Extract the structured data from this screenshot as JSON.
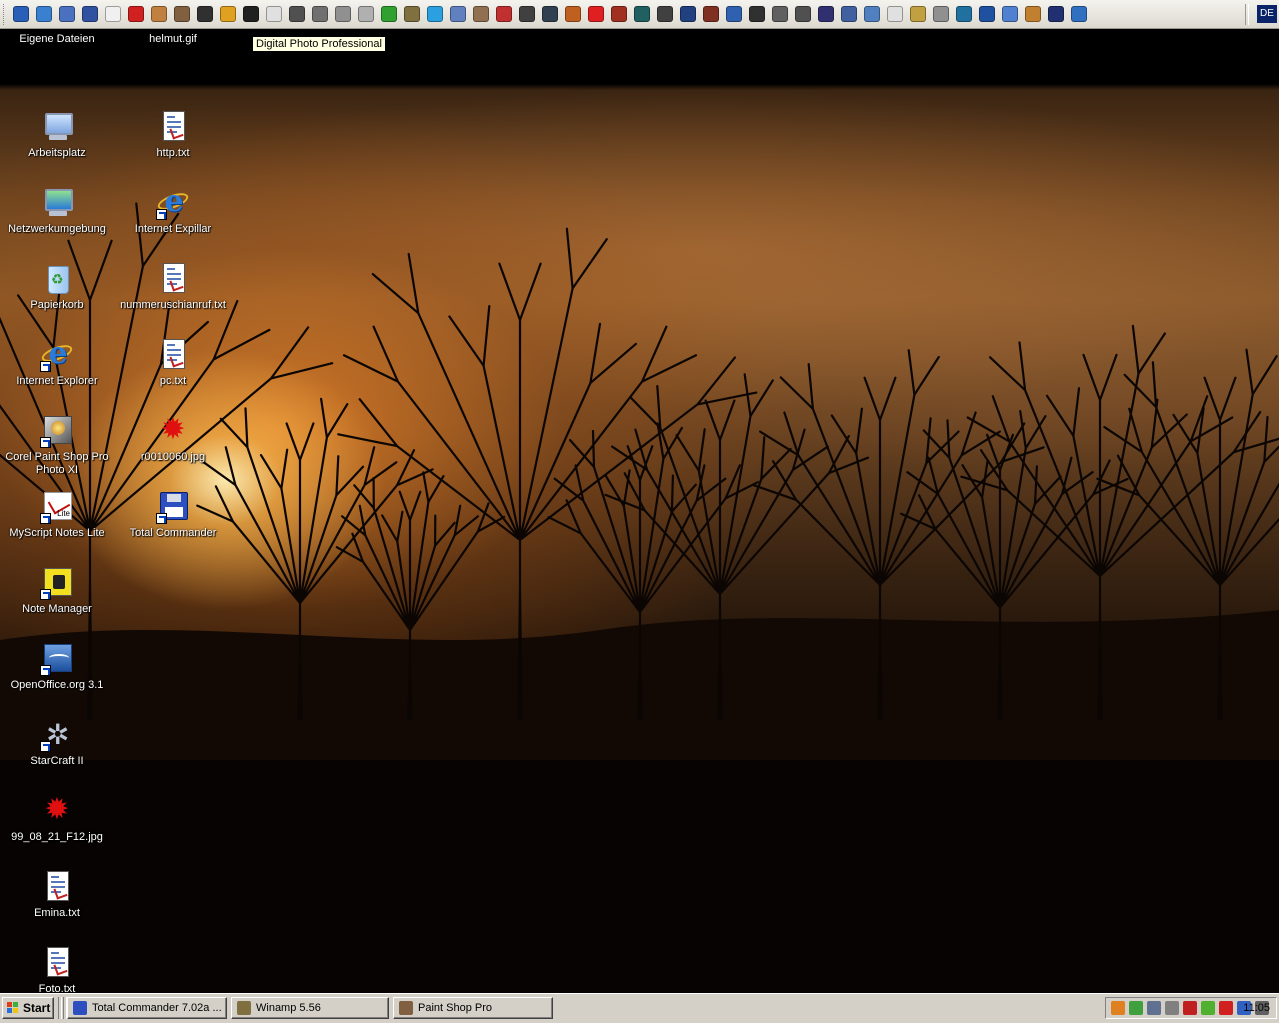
{
  "tooltip": "Digital Photo Professional",
  "language_indicator": "DE",
  "quick_launch": [
    {
      "icon": "outlook-icon",
      "color": "#2a5fb8"
    },
    {
      "icon": "ie-icon",
      "color": "#3a80d0"
    },
    {
      "icon": "desktop-icon",
      "color": "#4a70c0"
    },
    {
      "icon": "save-icon",
      "color": "#3050a0"
    },
    {
      "icon": "window-icon",
      "color": "#f0f0f0"
    },
    {
      "icon": "star-icon",
      "color": "#d02020"
    },
    {
      "icon": "pen-icon",
      "color": "#c08040"
    },
    {
      "icon": "tools-icon",
      "color": "#806040"
    },
    {
      "icon": "photo-icon",
      "color": "#303030"
    },
    {
      "icon": "media-icon",
      "color": "#e0a020"
    },
    {
      "icon": "camera-icon",
      "color": "#202020"
    },
    {
      "icon": "home-icon",
      "color": "#e0e0e0"
    },
    {
      "icon": "edit-icon",
      "color": "#505050"
    },
    {
      "icon": "monitor-icon",
      "color": "#707070"
    },
    {
      "icon": "calculator-icon",
      "color": "#909090"
    },
    {
      "icon": "avi-icon",
      "color": "#b0b0b0"
    },
    {
      "icon": "flower-icon",
      "color": "#30a030"
    },
    {
      "icon": "winamp-icon",
      "color": "#807040"
    },
    {
      "icon": "skype-icon",
      "color": "#2aa0e0"
    },
    {
      "icon": "grid-icon",
      "color": "#6080c0"
    },
    {
      "icon": "film-icon",
      "color": "#907050"
    },
    {
      "icon": "record-icon",
      "color": "#c03030"
    },
    {
      "icon": "clapper-icon",
      "color": "#404040"
    },
    {
      "icon": "book-icon",
      "color": "#304050"
    },
    {
      "icon": "people-icon",
      "color": "#c06020"
    },
    {
      "icon": "stop-icon",
      "color": "#e02020"
    },
    {
      "icon": "agent-icon",
      "color": "#a03020"
    },
    {
      "icon": "globe-icon",
      "color": "#206060"
    },
    {
      "icon": "wings-icon",
      "color": "#404040"
    },
    {
      "icon": "v-icon",
      "color": "#204080"
    },
    {
      "icon": "mask-icon",
      "color": "#803020"
    },
    {
      "icon": "chart-icon",
      "color": "#3060b0"
    },
    {
      "icon": "face-icon",
      "color": "#303030"
    },
    {
      "icon": "tools2-icon",
      "color": "#606060"
    },
    {
      "icon": "eye-icon",
      "color": "#505050"
    },
    {
      "icon": "pda-icon",
      "color": "#303070"
    },
    {
      "icon": "phone-icon",
      "color": "#4060a0"
    },
    {
      "icon": "disc-icon",
      "color": "#5080c0"
    },
    {
      "icon": "cd-icon",
      "color": "#e0e0e0"
    },
    {
      "icon": "brush-icon",
      "color": "#c0a040"
    },
    {
      "icon": "printer-icon",
      "color": "#909090"
    },
    {
      "icon": "drive-icon",
      "color": "#2070a0"
    },
    {
      "icon": "server-icon",
      "color": "#2050a0"
    },
    {
      "icon": "notepad-icon",
      "color": "#5080d0"
    },
    {
      "icon": "folder-icon",
      "color": "#c08030"
    },
    {
      "icon": "image-icon",
      "color": "#203070"
    },
    {
      "icon": "ie2-icon",
      "color": "#3070c0"
    }
  ],
  "desktop_icons": [
    {
      "name": "eigene-dateien",
      "label": "Eigene Dateien",
      "type": "generic"
    },
    {
      "name": "helmut-gif",
      "label": "helmut.gif",
      "type": "splat"
    },
    {
      "name": "arbeitsplatz",
      "label": "Arbeitsplatz",
      "type": "pc"
    },
    {
      "name": "http-txt",
      "label": "http.txt",
      "type": "doc"
    },
    {
      "name": "netzwerkumgebung",
      "label": "Netzwerkumgebung",
      "type": "network"
    },
    {
      "name": "internet-expillar",
      "label": "Internet Expillar",
      "type": "ie"
    },
    {
      "name": "papierkorb",
      "label": "Papierkorb",
      "type": "bin"
    },
    {
      "name": "nummeruschianruf-txt",
      "label": "nummeruschianruf.txt",
      "type": "doc"
    },
    {
      "name": "internet-explorer",
      "label": "Internet Explorer",
      "type": "ie"
    },
    {
      "name": "pc-txt",
      "label": "pc.txt",
      "type": "doc"
    },
    {
      "name": "corel-paint-shop-pro",
      "label": "Corel Paint Shop Pro Photo XI",
      "type": "psp"
    },
    {
      "name": "r0010060-jpg",
      "label": "r0010060.jpg",
      "type": "splat"
    },
    {
      "name": "myscript-notes-lite",
      "label": "MyScript Notes Lite",
      "type": "myscript"
    },
    {
      "name": "total-commander",
      "label": "Total Commander",
      "type": "floppy"
    },
    {
      "name": "note-manager",
      "label": "Note Manager",
      "type": "notemgr"
    },
    {
      "name": "openoffice",
      "label": "OpenOffice.org 3.1",
      "type": "ooo"
    },
    {
      "name": "starcraft-ii",
      "label": "StarCraft II",
      "type": "sc2"
    },
    {
      "name": "99-08-21-f12-jpg",
      "label": "99_08_21_F12.jpg",
      "type": "splat"
    },
    {
      "name": "emina-txt",
      "label": "Emina.txt",
      "type": "doc"
    },
    {
      "name": "foto-txt",
      "label": "Foto.txt",
      "type": "doc"
    }
  ],
  "taskbar": {
    "start_label": "Start",
    "tasks": [
      {
        "label": "Total Commander 7.02a ...",
        "icon": "floppy-icon",
        "color": "#2e4fbf"
      },
      {
        "label": "Winamp 5.56",
        "icon": "winamp-icon",
        "color": "#807040"
      },
      {
        "label": "Paint Shop Pro",
        "icon": "psp-icon",
        "color": "#806040"
      }
    ],
    "tray_icons": [
      {
        "icon": "tray-orange-icon",
        "color": "#e08020"
      },
      {
        "icon": "tray-network-icon",
        "color": "#40a040"
      },
      {
        "icon": "tray-pc-icon",
        "color": "#607090"
      },
      {
        "icon": "tray-speaker-icon",
        "color": "#808080"
      },
      {
        "icon": "tray-tools-icon",
        "color": "#c02020"
      },
      {
        "icon": "tray-nvidia-icon",
        "color": "#50b030"
      },
      {
        "icon": "tray-acrobat-icon",
        "color": "#d02020"
      },
      {
        "icon": "tray-sync-icon",
        "color": "#3060c0"
      },
      {
        "icon": "tray-shield-icon",
        "color": "#606060"
      }
    ],
    "clock": "11:05"
  }
}
